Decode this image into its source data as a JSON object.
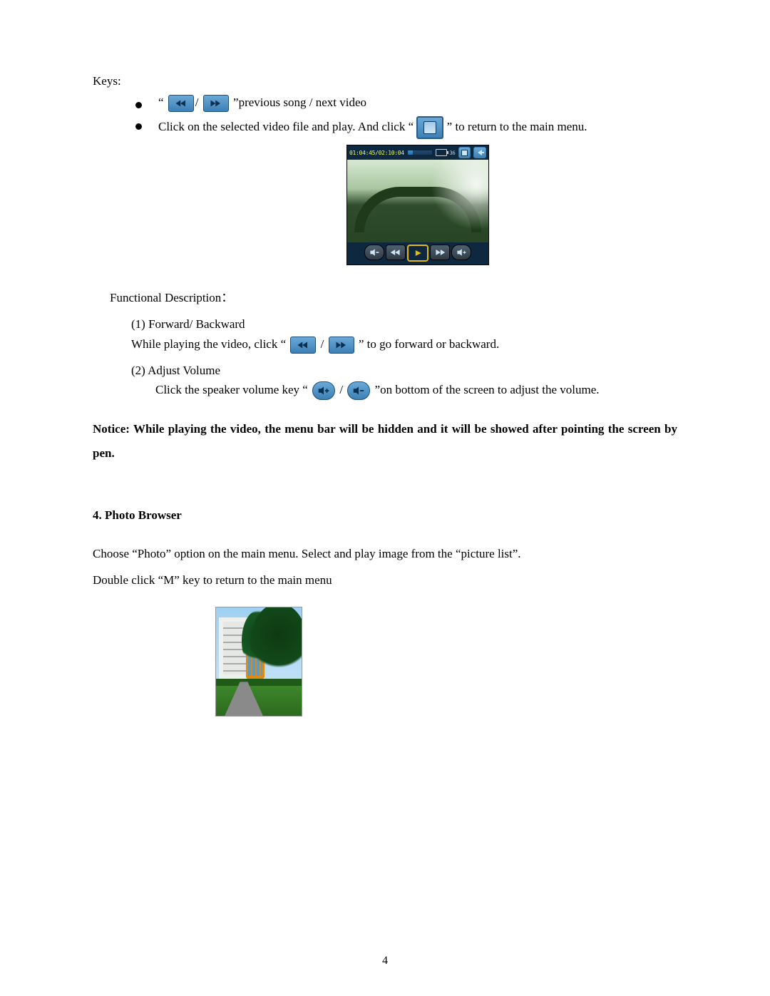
{
  "keys_label": "Keys:",
  "bullet1_prefix": "“",
  "bullet1_mid_slash": "/",
  "bullet1_suffix": "”previous song / next video",
  "bullet2_a": "Click on the selected video file and play. And click “",
  "bullet2_b": "” to return to the main menu.",
  "player": {
    "time": "01:04:45/02:10:04",
    "battery_hint": "36"
  },
  "func_desc_label": "Functional Description：",
  "item1_title": "(1)  Forward/ Backward",
  "item1_a": "While playing the video, click “ ",
  "item1_mid": "  /  ",
  "item1_b": "  ” to go forward or backward.",
  "item2_title": "(2) Adjust Volume",
  "item2_a": "Click the speaker volume key “",
  "item2_mid": " / ",
  "item2_b": "”on bottom of the screen to adjust the volume.",
  "notice": "Notice: While playing the video, the menu bar will be hidden and it will be showed after pointing the screen by pen.",
  "section4": "4. Photo Browser",
  "photo_p1": "Choose “Photo” option on the main menu. Select and play image from the “picture list”.",
  "photo_p2": "Double click “M” key to return to the main menu",
  "page_number": "4"
}
